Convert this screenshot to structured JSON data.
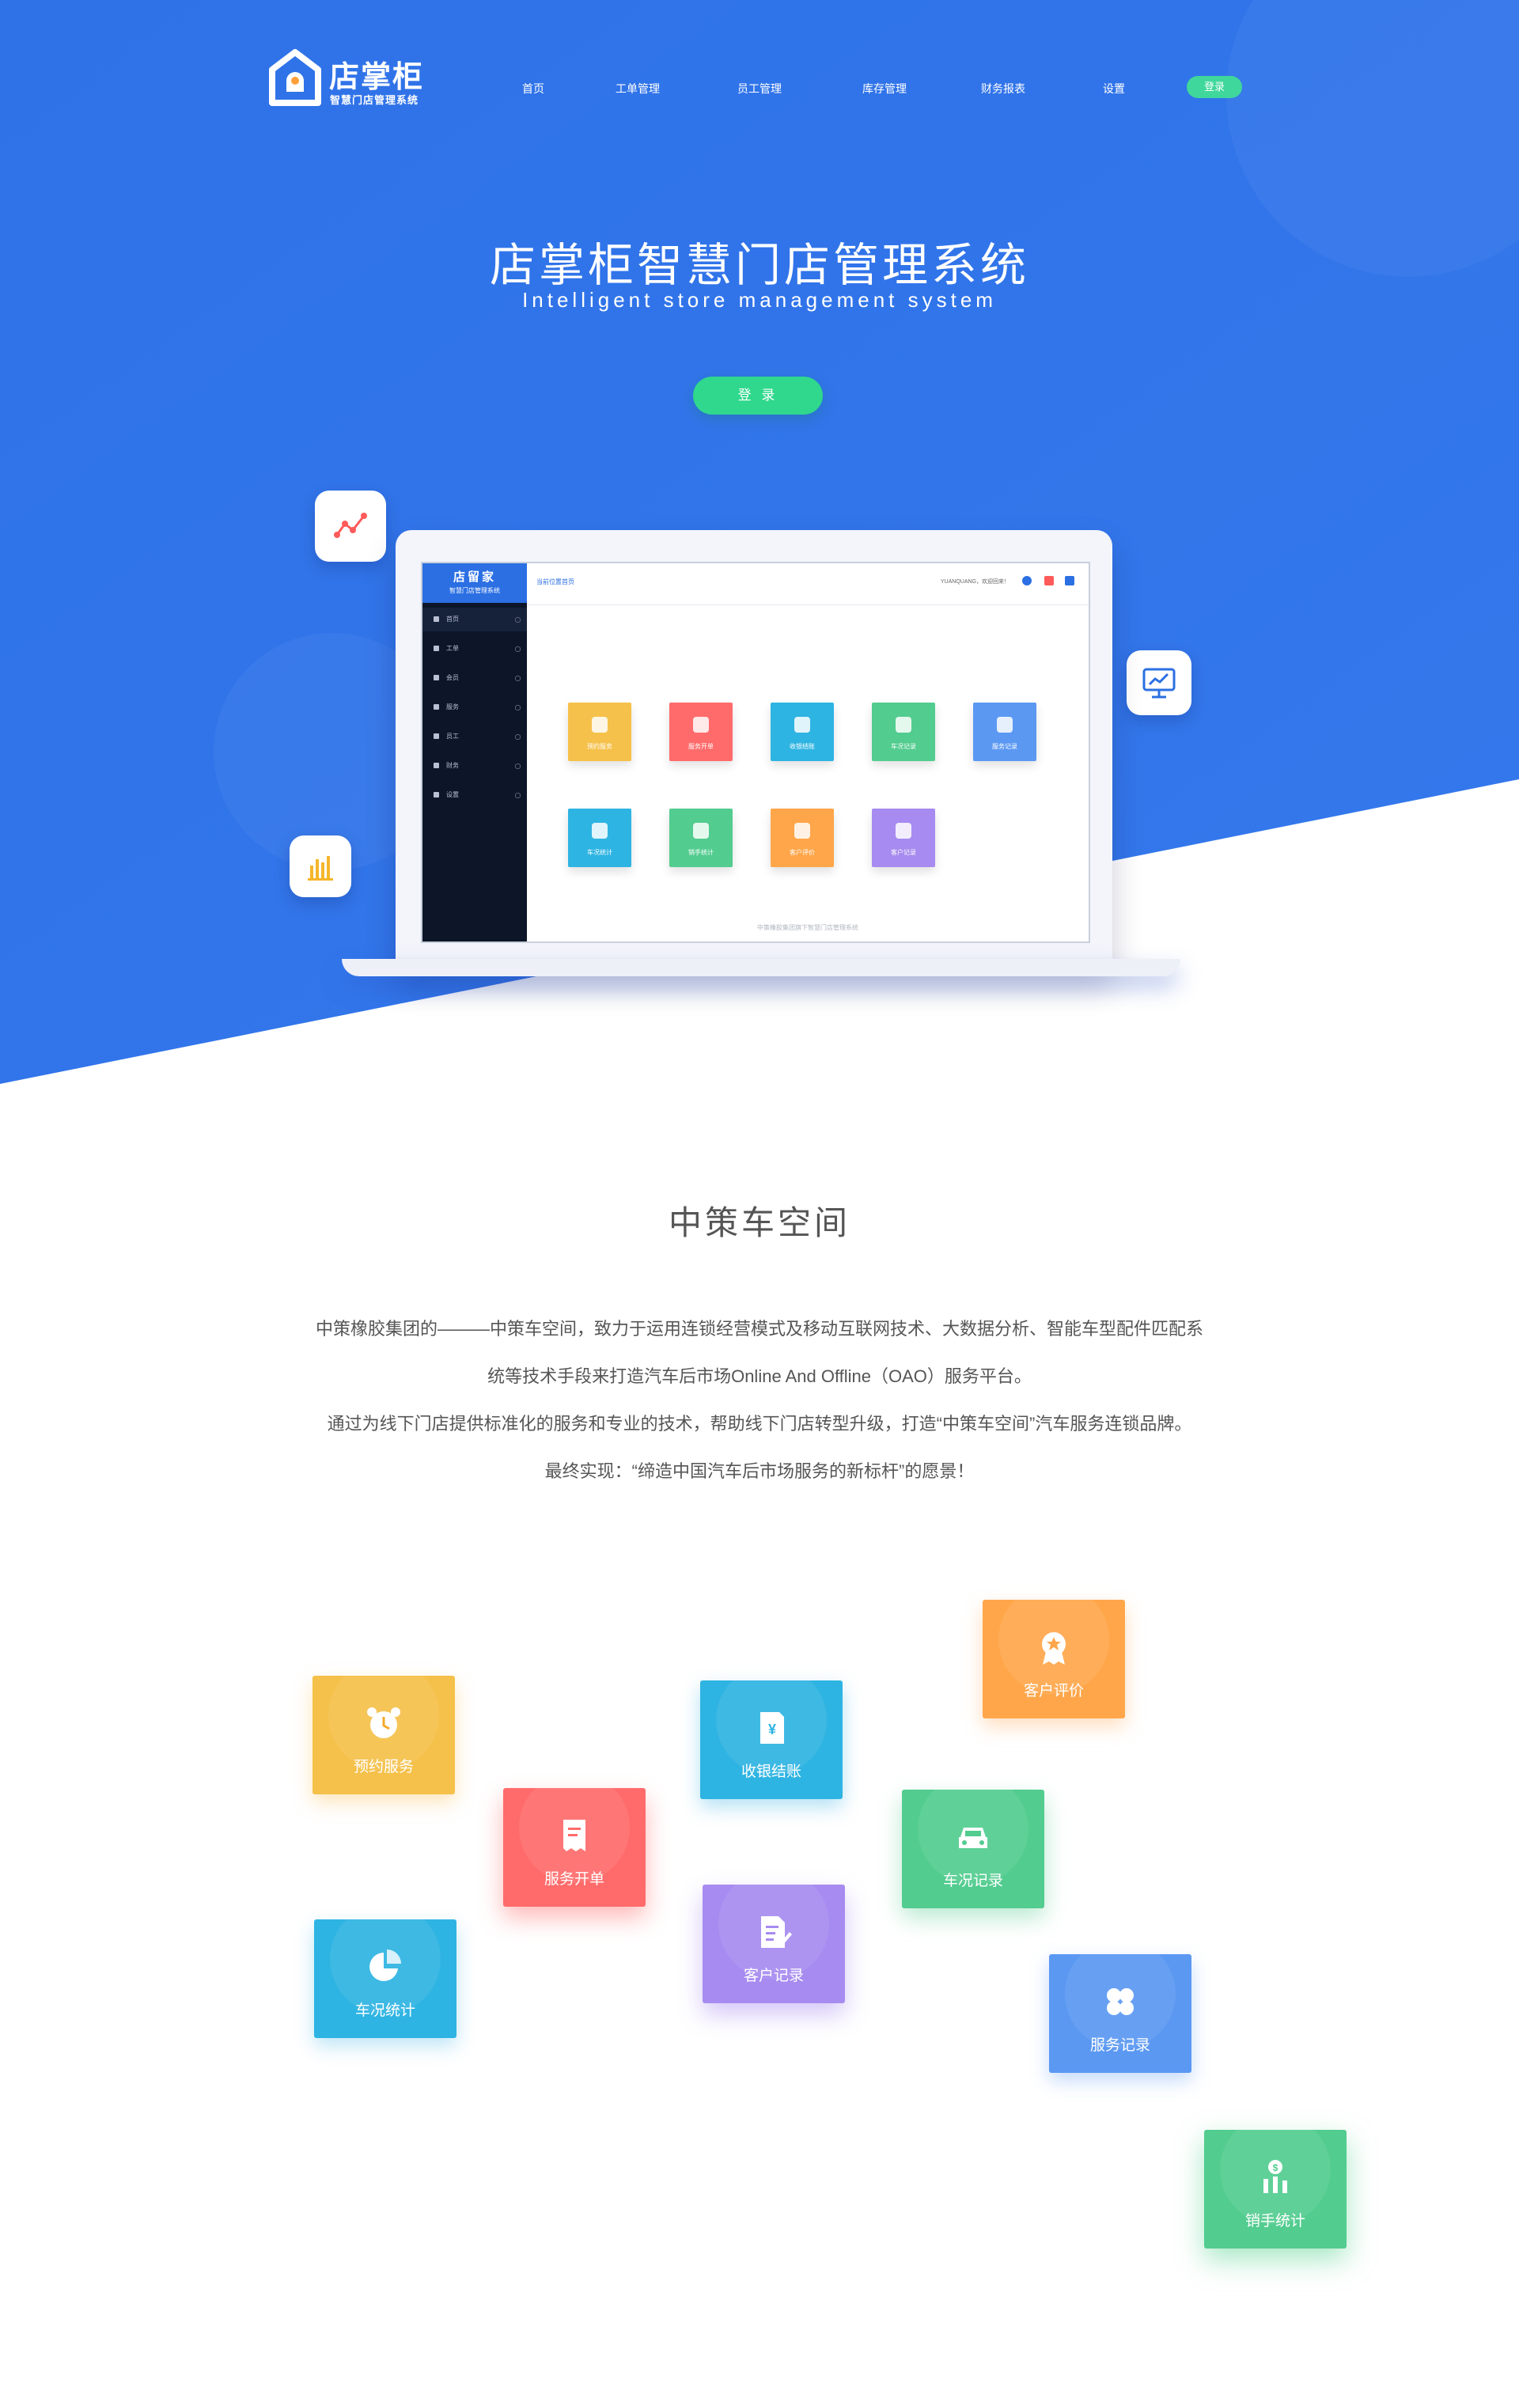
{
  "nav": {
    "logo_title": "店掌柜",
    "logo_subtitle": "智慧门店管理系统",
    "items": [
      "首页",
      "工单管理",
      "员工管理",
      "库存管理",
      "财务报表",
      "设置"
    ],
    "login_label": "登录"
  },
  "hero": {
    "title": "店掌柜智慧门店管理系统",
    "subtitle": "Intelligent store management system",
    "login_button": "登 录"
  },
  "screen": {
    "brand": "店留家",
    "brand_sub": "智慧门店管理系统",
    "menu": [
      "首页",
      "工单",
      "会员",
      "服务",
      "员工",
      "财务",
      "设置"
    ],
    "breadcrumb": "当前位置首页",
    "user_text": "YUANQUANG，欢迎回来！",
    "tiles_row1": [
      "预约服务",
      "服务开单",
      "收银结账",
      "车况记录",
      "服务记录"
    ],
    "tiles_row2": [
      "车况统计",
      "销手统计",
      "客户评价",
      "客户记录"
    ],
    "footer": "中策橡胶集团旗下智慧门店管理系统"
  },
  "intro": {
    "title": "中策车空间",
    "lines": [
      "中策橡胶集团的———中策车空间，致力于运用连锁经营模式及移动互联网技术、大数据分析、智能车型配件匹配系",
      "统等技术手段来打造汽车后市场Online And Offline（OAO）服务平台。",
      "通过为线下门店提供标准化的服务和专业的技术，帮助线下门店转型升级，打造“中策车空间”汽车服务连锁品牌。",
      "最终实现：“缔造中国汽车后市场服务的新标杆”的愿景！"
    ]
  },
  "cards": {
    "yuyue": "预约服务",
    "kaidan": "服务开单",
    "shouyin": "收银结账",
    "pingjia": "客户评价",
    "chekuang_jilu": "车况记录",
    "chekuang_tongji": "车况统计",
    "kehu_jilu": "客户记录",
    "fuwu_jilu": "服务记录",
    "xiaoshou": "销手统计"
  },
  "colors": {
    "hero_blue": "#2f72e8",
    "green": "#2fd88c",
    "yellow": "#f5c14a",
    "red": "#ff6b6b",
    "cyan": "#2eb4e2",
    "orange": "#ffa64a",
    "teal": "#52cc8f",
    "purple": "#a78bf0",
    "blue": "#5b98f2"
  }
}
